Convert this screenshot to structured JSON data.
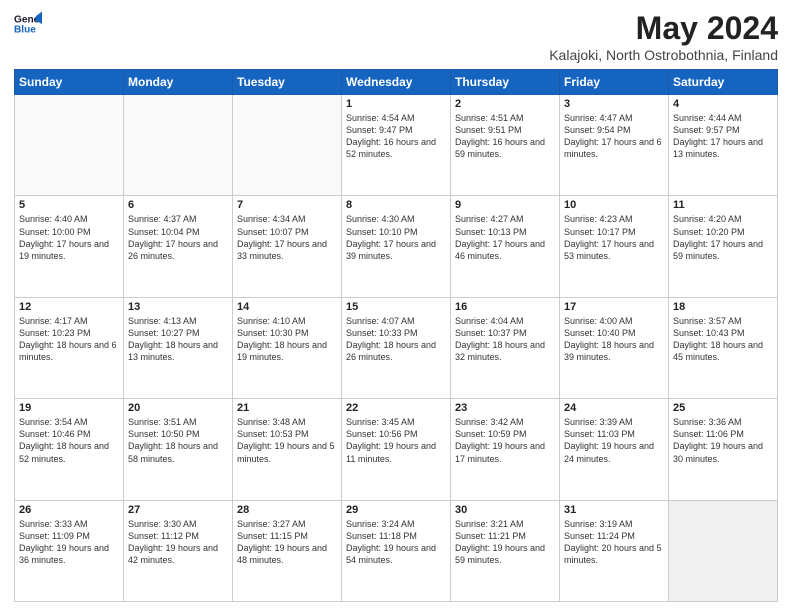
{
  "header": {
    "logo_line1": "General",
    "logo_line2": "Blue",
    "title": "May 2024",
    "subtitle": "Kalajoki, North Ostrobothnia, Finland"
  },
  "days_of_week": [
    "Sunday",
    "Monday",
    "Tuesday",
    "Wednesday",
    "Thursday",
    "Friday",
    "Saturday"
  ],
  "weeks": [
    [
      {
        "day": "",
        "info": ""
      },
      {
        "day": "",
        "info": ""
      },
      {
        "day": "",
        "info": ""
      },
      {
        "day": "1",
        "info": "Sunrise: 4:54 AM\nSunset: 9:47 PM\nDaylight: 16 hours and 52 minutes."
      },
      {
        "day": "2",
        "info": "Sunrise: 4:51 AM\nSunset: 9:51 PM\nDaylight: 16 hours and 59 minutes."
      },
      {
        "day": "3",
        "info": "Sunrise: 4:47 AM\nSunset: 9:54 PM\nDaylight: 17 hours and 6 minutes."
      },
      {
        "day": "4",
        "info": "Sunrise: 4:44 AM\nSunset: 9:57 PM\nDaylight: 17 hours and 13 minutes."
      }
    ],
    [
      {
        "day": "5",
        "info": "Sunrise: 4:40 AM\nSunset: 10:00 PM\nDaylight: 17 hours and 19 minutes."
      },
      {
        "day": "6",
        "info": "Sunrise: 4:37 AM\nSunset: 10:04 PM\nDaylight: 17 hours and 26 minutes."
      },
      {
        "day": "7",
        "info": "Sunrise: 4:34 AM\nSunset: 10:07 PM\nDaylight: 17 hours and 33 minutes."
      },
      {
        "day": "8",
        "info": "Sunrise: 4:30 AM\nSunset: 10:10 PM\nDaylight: 17 hours and 39 minutes."
      },
      {
        "day": "9",
        "info": "Sunrise: 4:27 AM\nSunset: 10:13 PM\nDaylight: 17 hours and 46 minutes."
      },
      {
        "day": "10",
        "info": "Sunrise: 4:23 AM\nSunset: 10:17 PM\nDaylight: 17 hours and 53 minutes."
      },
      {
        "day": "11",
        "info": "Sunrise: 4:20 AM\nSunset: 10:20 PM\nDaylight: 17 hours and 59 minutes."
      }
    ],
    [
      {
        "day": "12",
        "info": "Sunrise: 4:17 AM\nSunset: 10:23 PM\nDaylight: 18 hours and 6 minutes."
      },
      {
        "day": "13",
        "info": "Sunrise: 4:13 AM\nSunset: 10:27 PM\nDaylight: 18 hours and 13 minutes."
      },
      {
        "day": "14",
        "info": "Sunrise: 4:10 AM\nSunset: 10:30 PM\nDaylight: 18 hours and 19 minutes."
      },
      {
        "day": "15",
        "info": "Sunrise: 4:07 AM\nSunset: 10:33 PM\nDaylight: 18 hours and 26 minutes."
      },
      {
        "day": "16",
        "info": "Sunrise: 4:04 AM\nSunset: 10:37 PM\nDaylight: 18 hours and 32 minutes."
      },
      {
        "day": "17",
        "info": "Sunrise: 4:00 AM\nSunset: 10:40 PM\nDaylight: 18 hours and 39 minutes."
      },
      {
        "day": "18",
        "info": "Sunrise: 3:57 AM\nSunset: 10:43 PM\nDaylight: 18 hours and 45 minutes."
      }
    ],
    [
      {
        "day": "19",
        "info": "Sunrise: 3:54 AM\nSunset: 10:46 PM\nDaylight: 18 hours and 52 minutes."
      },
      {
        "day": "20",
        "info": "Sunrise: 3:51 AM\nSunset: 10:50 PM\nDaylight: 18 hours and 58 minutes."
      },
      {
        "day": "21",
        "info": "Sunrise: 3:48 AM\nSunset: 10:53 PM\nDaylight: 19 hours and 5 minutes."
      },
      {
        "day": "22",
        "info": "Sunrise: 3:45 AM\nSunset: 10:56 PM\nDaylight: 19 hours and 11 minutes."
      },
      {
        "day": "23",
        "info": "Sunrise: 3:42 AM\nSunset: 10:59 PM\nDaylight: 19 hours and 17 minutes."
      },
      {
        "day": "24",
        "info": "Sunrise: 3:39 AM\nSunset: 11:03 PM\nDaylight: 19 hours and 24 minutes."
      },
      {
        "day": "25",
        "info": "Sunrise: 3:36 AM\nSunset: 11:06 PM\nDaylight: 19 hours and 30 minutes."
      }
    ],
    [
      {
        "day": "26",
        "info": "Sunrise: 3:33 AM\nSunset: 11:09 PM\nDaylight: 19 hours and 36 minutes."
      },
      {
        "day": "27",
        "info": "Sunrise: 3:30 AM\nSunset: 11:12 PM\nDaylight: 19 hours and 42 minutes."
      },
      {
        "day": "28",
        "info": "Sunrise: 3:27 AM\nSunset: 11:15 PM\nDaylight: 19 hours and 48 minutes."
      },
      {
        "day": "29",
        "info": "Sunrise: 3:24 AM\nSunset: 11:18 PM\nDaylight: 19 hours and 54 minutes."
      },
      {
        "day": "30",
        "info": "Sunrise: 3:21 AM\nSunset: 11:21 PM\nDaylight: 19 hours and 59 minutes."
      },
      {
        "day": "31",
        "info": "Sunrise: 3:19 AM\nSunset: 11:24 PM\nDaylight: 20 hours and 5 minutes."
      },
      {
        "day": "",
        "info": ""
      }
    ]
  ]
}
